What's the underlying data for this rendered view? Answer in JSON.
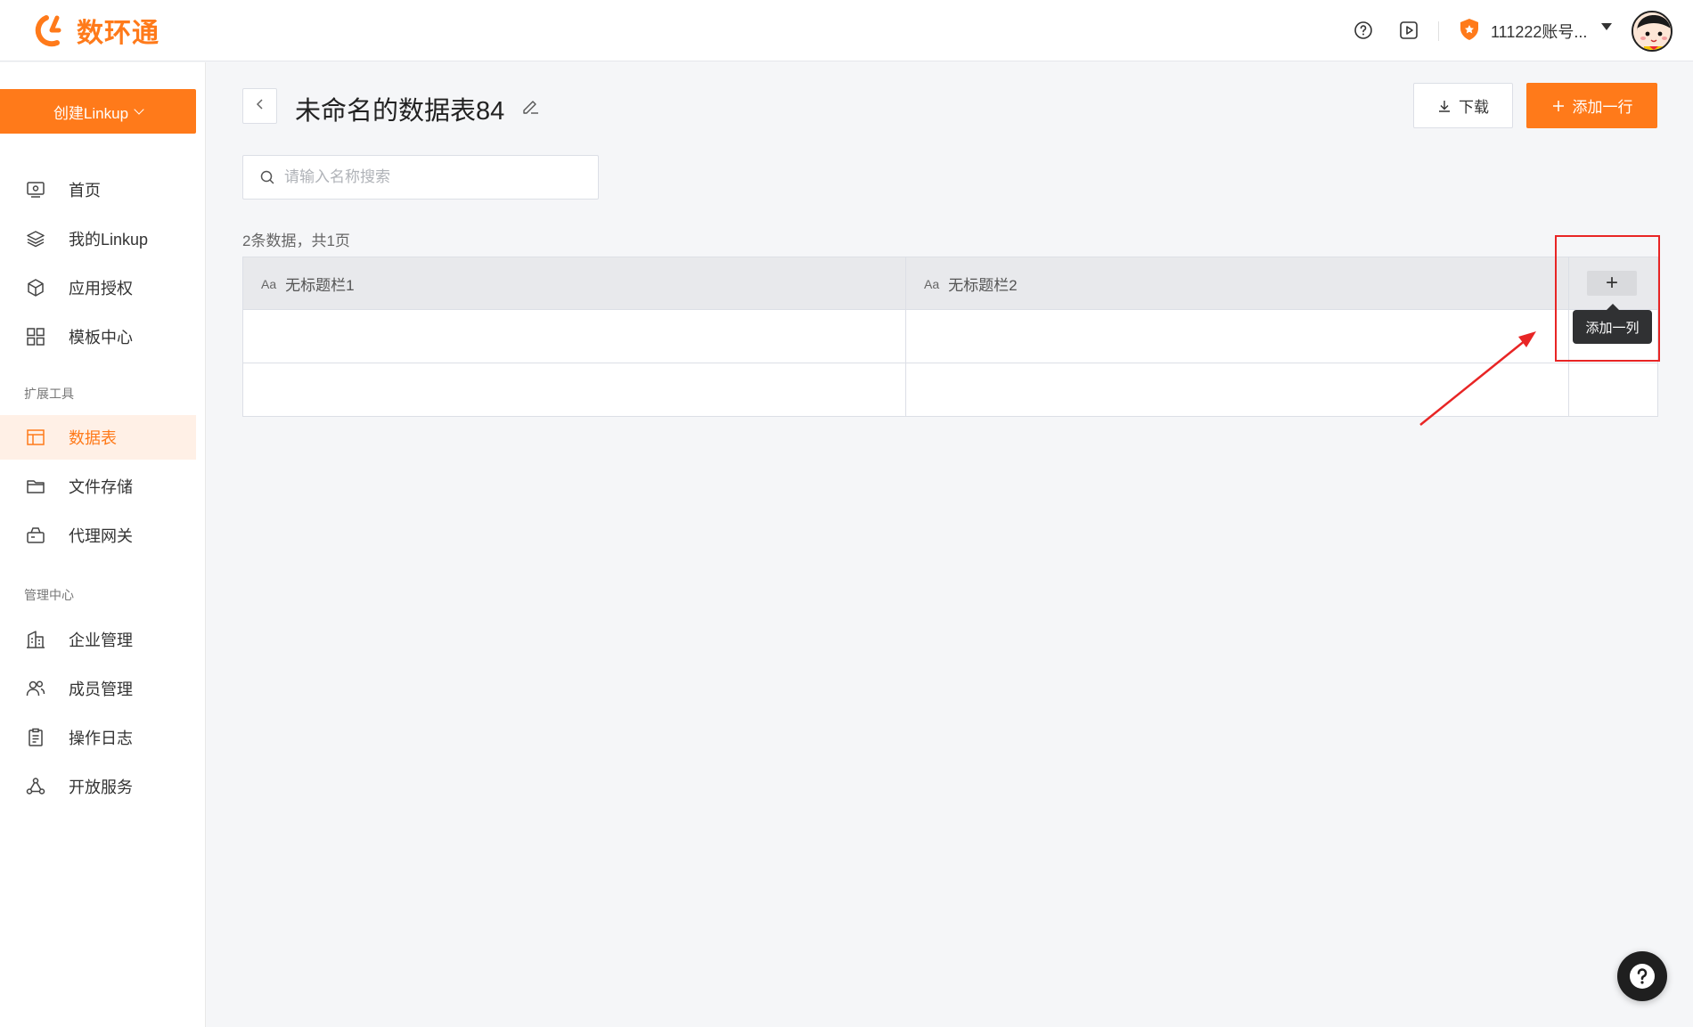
{
  "app": {
    "logo_text": "数环通",
    "brand_color": "#ff7a1a"
  },
  "topbar": {
    "help_icon": "question-circle-icon",
    "video_icon": "play-square-icon",
    "account_badge_icon": "shield-star-icon",
    "account_name": "111222账号...",
    "account_caret_icon": "caret-down-icon"
  },
  "sidebar": {
    "create_button": "创建Linkup",
    "items": [
      {
        "label": "首页",
        "icon": "monitor-icon"
      },
      {
        "label": "我的Linkup",
        "icon": "layers-icon"
      },
      {
        "label": "应用授权",
        "icon": "cube-icon"
      },
      {
        "label": "模板中心",
        "icon": "grid-icon"
      }
    ],
    "section_ext": "扩展工具",
    "ext_items": [
      {
        "label": "数据表",
        "icon": "table-icon",
        "active": true
      },
      {
        "label": "文件存储",
        "icon": "folder-icon"
      },
      {
        "label": "代理网关",
        "icon": "gateway-icon"
      }
    ],
    "section_admin": "管理中心",
    "admin_items": [
      {
        "label": "企业管理",
        "icon": "building-icon"
      },
      {
        "label": "成员管理",
        "icon": "users-icon"
      },
      {
        "label": "操作日志",
        "icon": "clipboard-icon"
      },
      {
        "label": "开放服务",
        "icon": "share-nodes-icon"
      }
    ]
  },
  "main": {
    "title": "未命名的数据表84",
    "download_label": "下载",
    "add_row_label": "添加一行",
    "search_placeholder": "请输入名称搜索",
    "count_text": "2条数据，共1页",
    "columns": [
      {
        "type_glyph": "Aa",
        "name": "无标题栏1"
      },
      {
        "type_glyph": "Aa",
        "name": "无标题栏2"
      }
    ],
    "rows": [
      [
        "",
        ""
      ],
      [
        "",
        ""
      ]
    ],
    "add_column_glyph": "+",
    "add_column_tooltip": "添加一列"
  },
  "annotation_color": "#e82525"
}
